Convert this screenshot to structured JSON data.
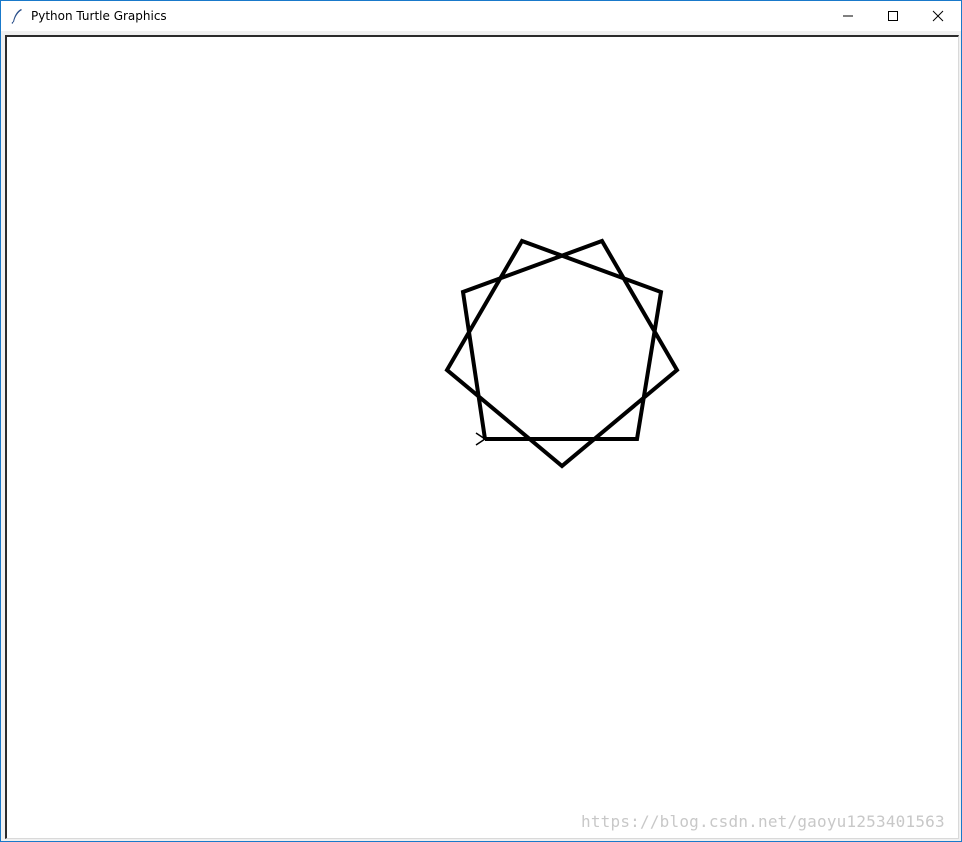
{
  "window": {
    "title": "Python Turtle Graphics",
    "icon": "feather-pen-icon",
    "border_color": "#1979ca"
  },
  "controls": {
    "minimize_icon": "minimize-icon",
    "maximize_icon": "maximize-icon",
    "close_icon": "close-icon"
  },
  "canvas": {
    "background": "#ffffff",
    "pen_color": "#000000",
    "turtle_icon": "turtle-arrow-icon"
  },
  "watermark": {
    "text": "https://blog.csdn.net/gaoyu1253401563",
    "color": "#c8c8c8"
  }
}
